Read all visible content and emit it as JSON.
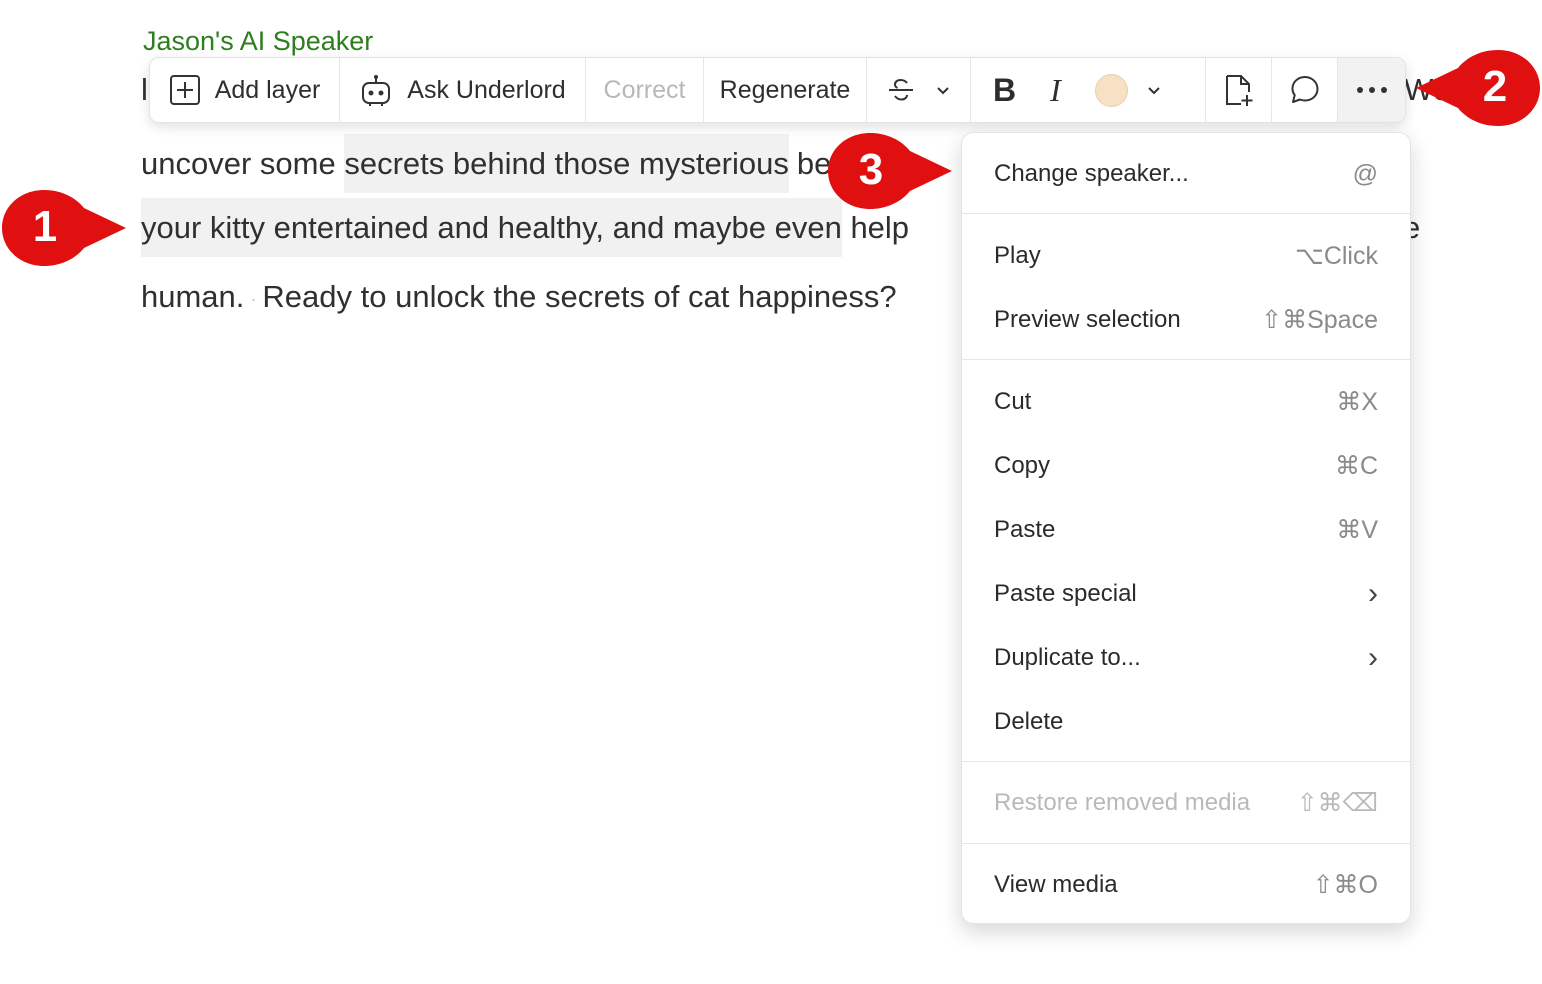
{
  "speaker": {
    "name": "Jason's AI Speaker"
  },
  "document": {
    "line1_left": "l",
    "line1_right": "We",
    "line2_plain": "uncover some ",
    "line2_highlight": "secrets behind those mysterious",
    "line2_tail": "be",
    "line3_highlight": "your kitty entertained and healthy, and maybe even",
    "line3_tail": " help",
    "line3_right": "e",
    "line4_a": "human.",
    "line4_sep": "·",
    "line4_b": "Ready to unlock the secrets of cat happiness?"
  },
  "toolbar": {
    "add_layer": "Add layer",
    "ask_underlord": "Ask Underlord",
    "correct": "Correct",
    "regenerate": "Regenerate",
    "bold_glyph": "B",
    "italic_glyph": "I",
    "highlight_color": "#f8e0c4",
    "icons": [
      "plus-square-icon",
      "robot-icon",
      "strikethrough-icon",
      "chevron-down-icon",
      "bold-icon",
      "italic-icon",
      "color-swatch-icon",
      "add-file-icon",
      "comment-icon",
      "more-icon"
    ]
  },
  "menu": {
    "items": [
      {
        "label": "Change speaker...",
        "shortcut": "@"
      },
      {
        "label": "Play",
        "shortcut": "⌥Click"
      },
      {
        "label": "Preview selection",
        "shortcut": "⇧⌘Space"
      },
      {
        "label": "Cut",
        "shortcut": "⌘X"
      },
      {
        "label": "Copy",
        "shortcut": "⌘C"
      },
      {
        "label": "Paste",
        "shortcut": "⌘V"
      },
      {
        "label": "Paste special",
        "shortcut": "›"
      },
      {
        "label": "Duplicate to...",
        "shortcut": "›"
      },
      {
        "label": "Delete",
        "shortcut": ""
      },
      {
        "label": "Restore removed media",
        "shortcut": "⇧⌘⌫"
      },
      {
        "label": "View media",
        "shortcut": "⇧⌘O"
      }
    ]
  },
  "callouts": {
    "one": "1",
    "two": "2",
    "three": "3",
    "color": "#e01010"
  }
}
